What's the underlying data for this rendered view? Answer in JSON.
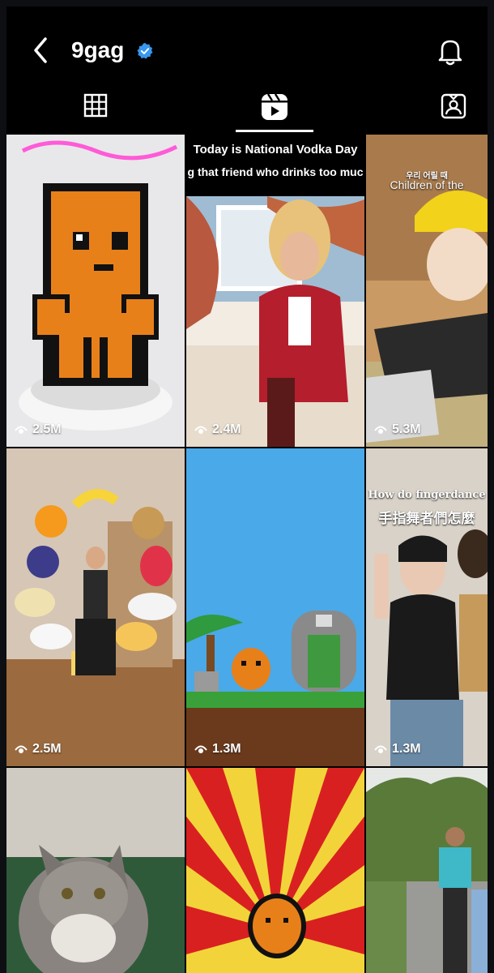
{
  "header": {
    "username": "9gag",
    "verified": true,
    "back_icon": "chevron-left-icon",
    "notification_icon": "bell-icon"
  },
  "tabs": [
    {
      "name": "grid",
      "icon": "grid-icon",
      "active": false
    },
    {
      "name": "reels",
      "icon": "reels-icon",
      "active": true
    },
    {
      "name": "tagged",
      "icon": "tagged-person-icon",
      "active": false
    }
  ],
  "reels": [
    {
      "id": "r1",
      "views": "2.5M",
      "overlay": []
    },
    {
      "id": "r2",
      "views": "2.4M",
      "overlay": [
        "Today is National Vodka Day",
        "g that friend who drinks too muc"
      ]
    },
    {
      "id": "r3",
      "views": "5.3M",
      "overlay": [
        "우리 어릴 때",
        "Children of the"
      ]
    },
    {
      "id": "r4",
      "views": "2.5M",
      "overlay": []
    },
    {
      "id": "r5",
      "views": "1.3M",
      "overlay": []
    },
    {
      "id": "r6",
      "views": "1.3M",
      "overlay": [
        "How do fingerdance",
        "手指舞者們怎麼"
      ]
    },
    {
      "id": "r7",
      "views": "",
      "overlay": []
    },
    {
      "id": "r8",
      "views": "",
      "overlay": []
    },
    {
      "id": "r9",
      "views": "",
      "overlay": []
    }
  ],
  "colors": {
    "background": "#000000",
    "verified_badge": "#3897f0",
    "text": "#ffffff"
  }
}
